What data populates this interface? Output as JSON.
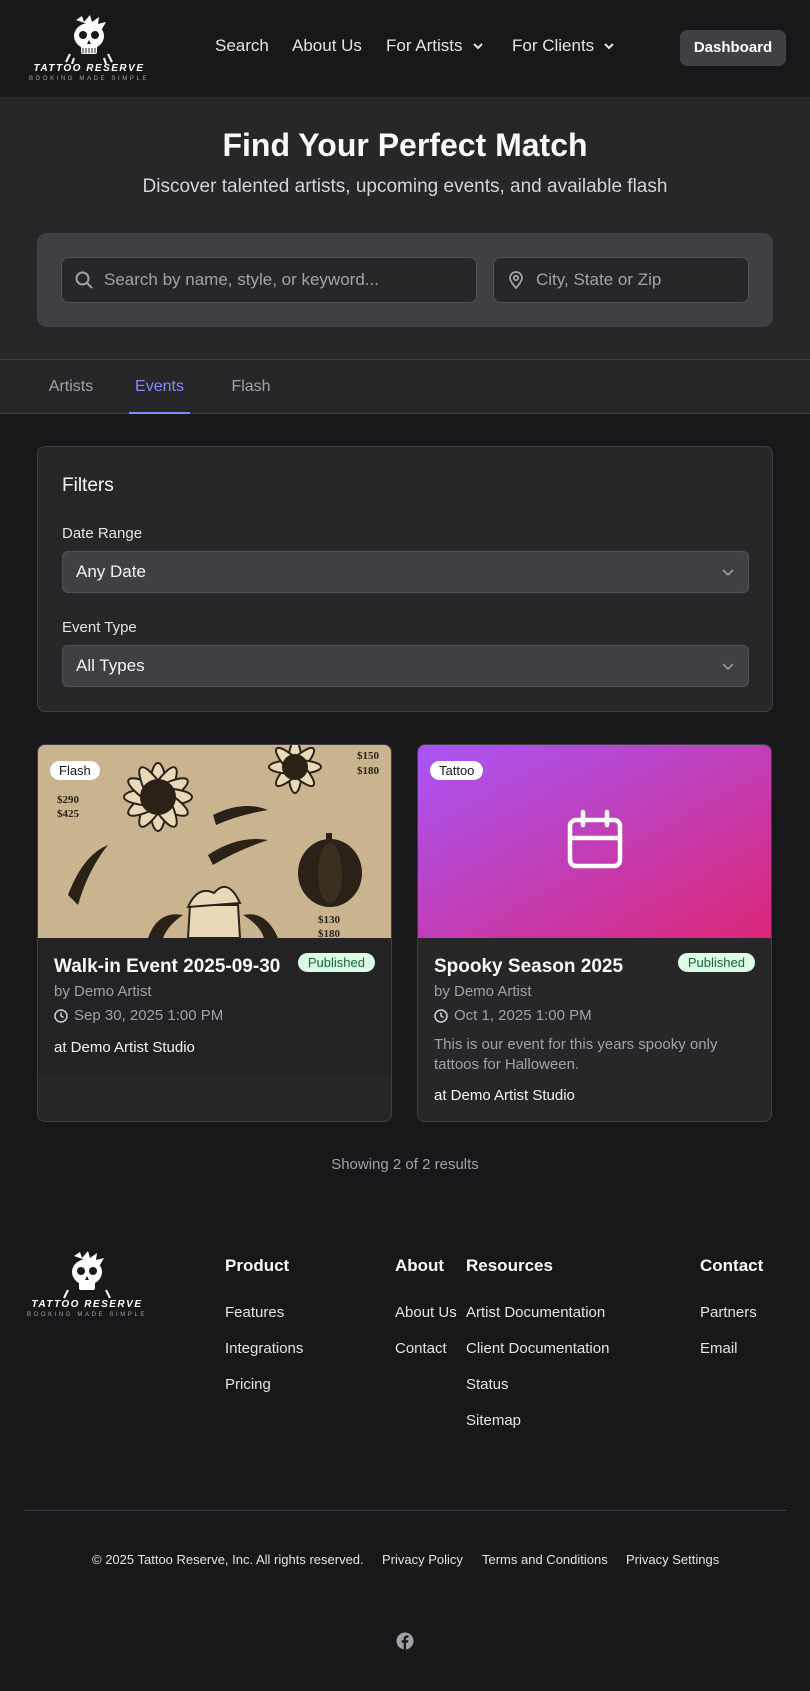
{
  "header": {
    "logo_brand": "TATTOO RESERVE",
    "logo_tagline": "BOOKING MADE SIMPLE",
    "nav": [
      {
        "label": "Search"
      },
      {
        "label": "About Us"
      },
      {
        "label": "For Artists",
        "icon": "chevron-down-icon"
      },
      {
        "label": "For Clients",
        "icon": "chevron-down-icon"
      }
    ],
    "dashboard_label": "Dashboard"
  },
  "hero": {
    "title": "Find Your Perfect Match",
    "subtitle": "Discover talented artists, upcoming events, and available flash",
    "search_placeholder": "Search by name, style, or keyword...",
    "location_placeholder": "City, State or Zip"
  },
  "tabs": [
    {
      "label": "Artists",
      "active": false
    },
    {
      "label": "Events",
      "active": true
    },
    {
      "label": "Flash",
      "active": false
    }
  ],
  "filters": {
    "title": "Filters",
    "date_label": "Date Range",
    "date_value": "Any Date",
    "type_label": "Event Type",
    "type_value": "All Types"
  },
  "events": [
    {
      "type": "Flash",
      "title": "Walk-in Event 2025-09-30",
      "status": "Published",
      "artist": "by Demo Artist",
      "date": "Sep 30, 2025 1:00 PM",
      "description": "",
      "location": "at Demo Artist Studio",
      "prices": [
        "$150",
        "$180",
        "$290",
        "$425",
        "$130",
        "$180"
      ]
    },
    {
      "type": "Tattoo",
      "title": "Spooky Season 2025",
      "status": "Published",
      "artist": "by Demo Artist",
      "date": "Oct 1, 2025 1:00 PM",
      "description": "This is our event for this years spooky only tattoos for Halloween.",
      "location": "at Demo Artist Studio",
      "media_icon": "calendar-icon"
    }
  ],
  "results_text": "Showing 2 of 2 results",
  "footer": {
    "columns": [
      {
        "title": "Product",
        "links": [
          "Features",
          "Integrations",
          "Pricing"
        ]
      },
      {
        "title": "About",
        "links": [
          "About Us",
          "Contact"
        ]
      },
      {
        "title": "Resources",
        "links": [
          "Artist Documentation",
          "Client Documentation",
          "Status",
          "Sitemap"
        ]
      },
      {
        "title": "Contact",
        "links": [
          "Partners",
          "Email"
        ]
      }
    ],
    "copyright": "© 2025 Tattoo Reserve, Inc. All rights reserved.",
    "legal": [
      "Privacy Policy",
      "Terms and Conditions",
      "Privacy Settings"
    ],
    "social_icon": "facebook-icon"
  },
  "colors": {
    "background": "#18181b",
    "panel": "#27272a",
    "accent": "#818cf8",
    "published_bg": "#dcfce7",
    "published_text": "#166534",
    "gradient_start": "#a855f7",
    "gradient_end": "#db2777"
  }
}
